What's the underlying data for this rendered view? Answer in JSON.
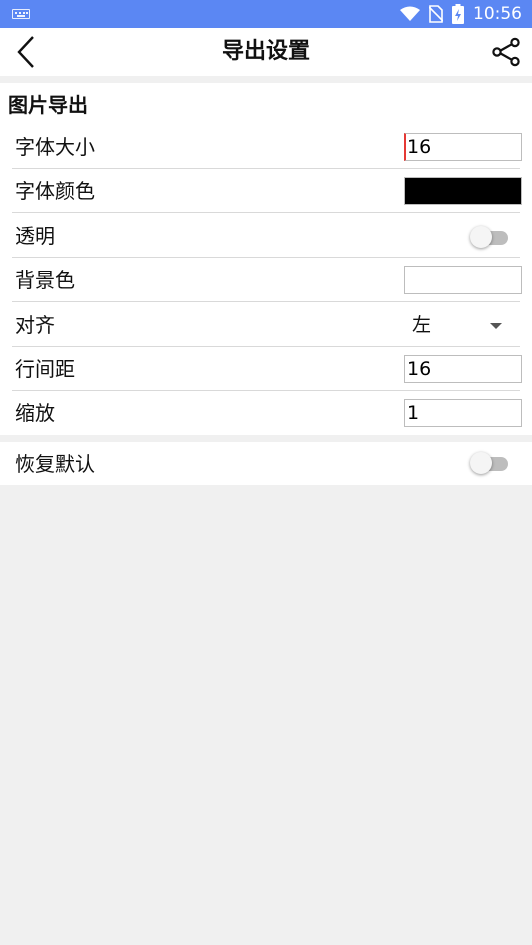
{
  "status_bar": {
    "time": "10:56"
  },
  "toolbar": {
    "title": "导出设置"
  },
  "image_export": {
    "section_title": "图片导出",
    "font_size": {
      "label": "字体大小",
      "value": "16"
    },
    "font_color": {
      "label": "字体颜色",
      "color": "#000000"
    },
    "transparent": {
      "label": "透明",
      "on": false
    },
    "background_color": {
      "label": "背景色",
      "color": "#ffffff"
    },
    "align": {
      "label": "对齐",
      "value": "左"
    },
    "line_spacing": {
      "label": "行间距",
      "value": "16"
    },
    "scale": {
      "label": "缩放",
      "value": "1"
    }
  },
  "restore_default": {
    "label": "恢复默认",
    "on": false
  },
  "colors": {
    "status_bar": "#5b87f3",
    "cursor": "#e53935"
  }
}
